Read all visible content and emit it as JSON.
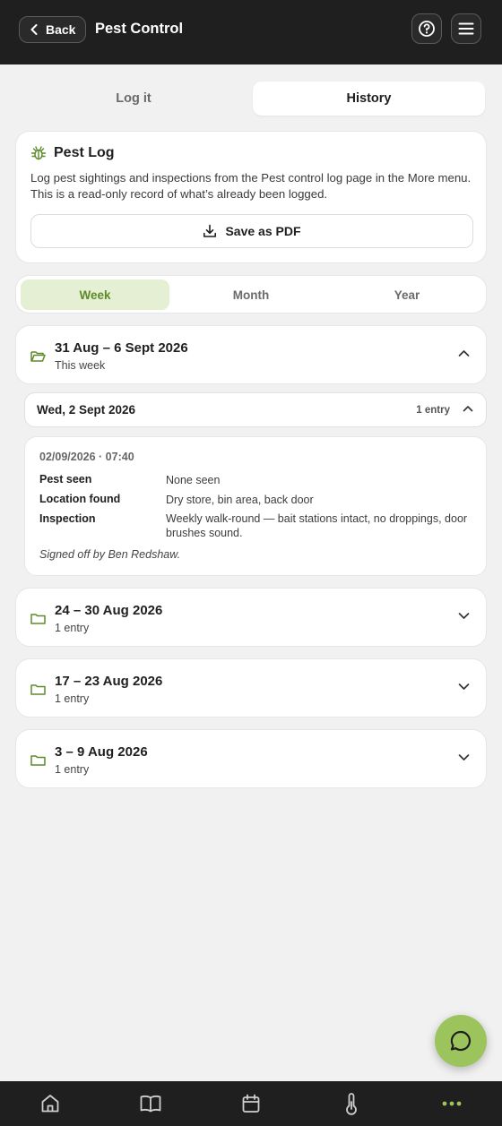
{
  "header": {
    "back_label": "Back",
    "title": "Pest Control",
    "help_icon": "help-circle-icon",
    "menu_icon": "menu-icon"
  },
  "tabs": [
    {
      "label": "Log it",
      "active": false
    },
    {
      "label": "History",
      "active": true
    }
  ],
  "info": {
    "title": "Pest Log",
    "icon": "bug-icon",
    "description": "Log pest sightings and inspections from the Pest control log page in the More menu. This is a read-only record of what’s already been logged.",
    "pdf_button": "Save as PDF"
  },
  "segments": [
    {
      "label": "Week",
      "active": true
    },
    {
      "label": "Month",
      "active": false
    },
    {
      "label": "Year",
      "active": false
    }
  ],
  "weeks": [
    {
      "range": "31 Aug – 6 Sept 2026",
      "sub": "This week",
      "expanded": true
    },
    {
      "range": "24 – 30 Aug 2026",
      "sub": "1 entry",
      "expanded": false
    },
    {
      "range": "17 – 23 Aug 2026",
      "sub": "1 entry",
      "expanded": false
    },
    {
      "range": "3 – 9 Aug 2026",
      "sub": "1 entry",
      "expanded": false
    }
  ],
  "day": {
    "label": "Wed, 2 Sept 2026",
    "count": "1 entry"
  },
  "entry": {
    "timestamp": "02/09/2026 · 07:40",
    "rows": [
      {
        "label": "Pest seen",
        "value": "None seen"
      },
      {
        "label": "Location found",
        "value": "Dry store, bin area, back door"
      },
      {
        "label": "Inspection",
        "value": "Weekly walk-round — bait stations intact, no droppings, door brushes sound."
      }
    ],
    "signed": "Signed off by Ben Redshaw."
  },
  "colors": {
    "accent": "#5f8a2a",
    "accent_soft": "#e4efd3",
    "fab": "#9bc45c",
    "bar": "#1f1f1f"
  },
  "bottom_nav": [
    {
      "icon": "home-icon"
    },
    {
      "icon": "book-icon"
    },
    {
      "icon": "calendar-icon"
    },
    {
      "icon": "thermometer-icon"
    },
    {
      "icon": "more-dots-icon",
      "active": true
    }
  ]
}
